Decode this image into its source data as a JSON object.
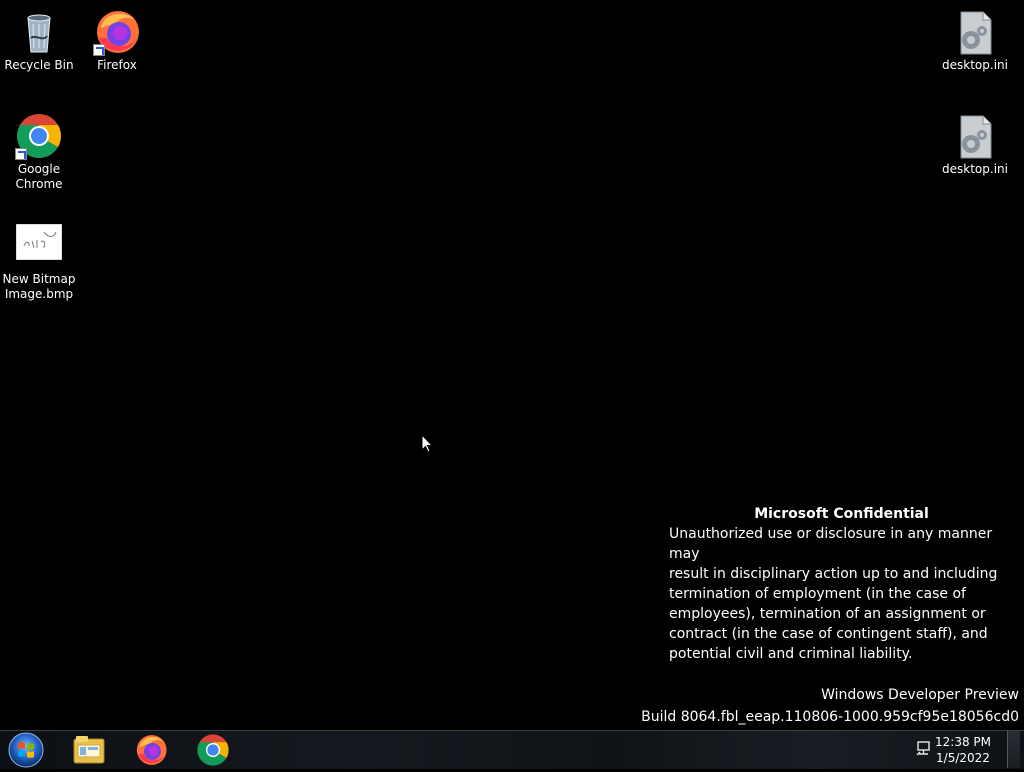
{
  "desktop": {
    "icons": [
      {
        "label": "Recycle Bin",
        "icon": "recycle-bin-icon"
      },
      {
        "label": "Firefox",
        "icon": "firefox-icon"
      },
      {
        "label": "Google Chrome",
        "icon": "chrome-icon"
      },
      {
        "label": "New Bitmap Image.bmp",
        "icon": "bitmap-image-icon"
      },
      {
        "label": "desktop.ini",
        "icon": "settings-file-icon"
      },
      {
        "label": "desktop.ini",
        "icon": "settings-file-icon"
      }
    ]
  },
  "confidential": {
    "title": "Microsoft Confidential",
    "lines": [
      "Unauthorized use or disclosure in any manner may",
      "result in disciplinary action up to and including",
      "termination of employment (in the case of",
      "employees), termination of an assignment or",
      "contract (in the case of contingent staff), and",
      "potential civil and criminal liability."
    ]
  },
  "watermark": {
    "edition": "Windows Developer Preview",
    "build": "Build 8064.fbl_eeap.110806-1000.959cf95e18056cd0"
  },
  "taskbar": {
    "pinned": [
      {
        "name": "file-explorer-icon"
      },
      {
        "name": "firefox-icon"
      },
      {
        "name": "chrome-icon"
      }
    ],
    "clock": {
      "time": "12:38 PM",
      "date": "1/5/2022"
    }
  },
  "colors": {
    "desktop_background": "#000000",
    "taskbar_background": "#12161b",
    "text": "#ffffff"
  }
}
